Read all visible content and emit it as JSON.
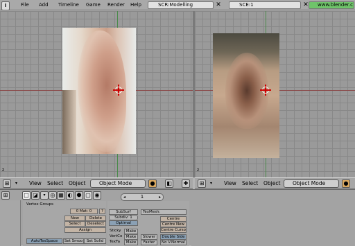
{
  "topbar": {
    "menus": [
      "File",
      "Add",
      "Timeline",
      "Game",
      "Render",
      "Help"
    ],
    "screen": "SCR:Modelling",
    "scene": "SCE:1",
    "website": "www.blender.c"
  },
  "view_header": {
    "menus": [
      "View",
      "Select",
      "Object"
    ],
    "mode": "Object Mode"
  },
  "viewport_axis_label": "z",
  "buttons": {
    "page_number": "1",
    "vertex_groups": "Vertex Groups",
    "mat_label": "0 Mat: 0",
    "mat_q": "?",
    "new": "New",
    "delete": "Delete",
    "select": "Select",
    "deselect": "Deselect",
    "assign": "Assign",
    "autotexspace": "AutoTexSpace",
    "set_smooth": "Set Smoo",
    "set_solid": "Set Solid",
    "subsurf": "SubSurf",
    "subdiv": "Subdiv: 1",
    "optimal": "Optimal",
    "texmesh": "TexMesh:",
    "sticky": "Sticky",
    "vertcol": "VertCo",
    "texface": "TexFa",
    "make1": "Make",
    "make2": "Make",
    "make3": "Make",
    "slower": "Slower",
    "faster": "Faster",
    "centre": "Centre",
    "centre_new": "Centre New",
    "centre_cursor": "Centre Cursor",
    "double_sided": "Double Side",
    "no_vnormal": "No V.Normal"
  }
}
